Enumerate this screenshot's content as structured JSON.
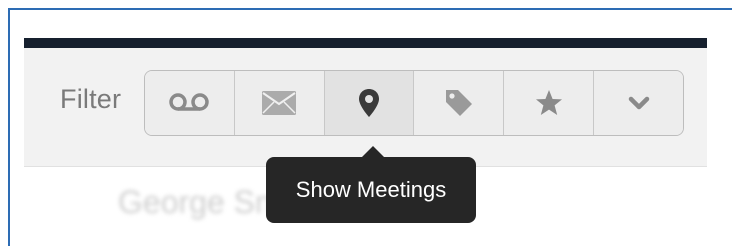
{
  "filter": {
    "label": "Filter"
  },
  "buttons": [
    {
      "name": "voicemail-filter-button",
      "icon": "voicemail-icon"
    },
    {
      "name": "email-filter-button",
      "icon": "envelope-icon"
    },
    {
      "name": "meetings-filter-button",
      "icon": "map-pin-icon",
      "active": true
    },
    {
      "name": "tag-filter-button",
      "icon": "tag-icon"
    },
    {
      "name": "starred-filter-button",
      "icon": "star-icon"
    },
    {
      "name": "more-filter-button",
      "icon": "chevron-down-icon"
    }
  ],
  "tooltip": {
    "text": "Show Meetings"
  },
  "background_text": "George Smith",
  "colors": {
    "top_bar": "#16202e",
    "tooltip_bg": "#262626",
    "icon": "#8a8a8a",
    "frame_border": "#2d6cb4"
  }
}
